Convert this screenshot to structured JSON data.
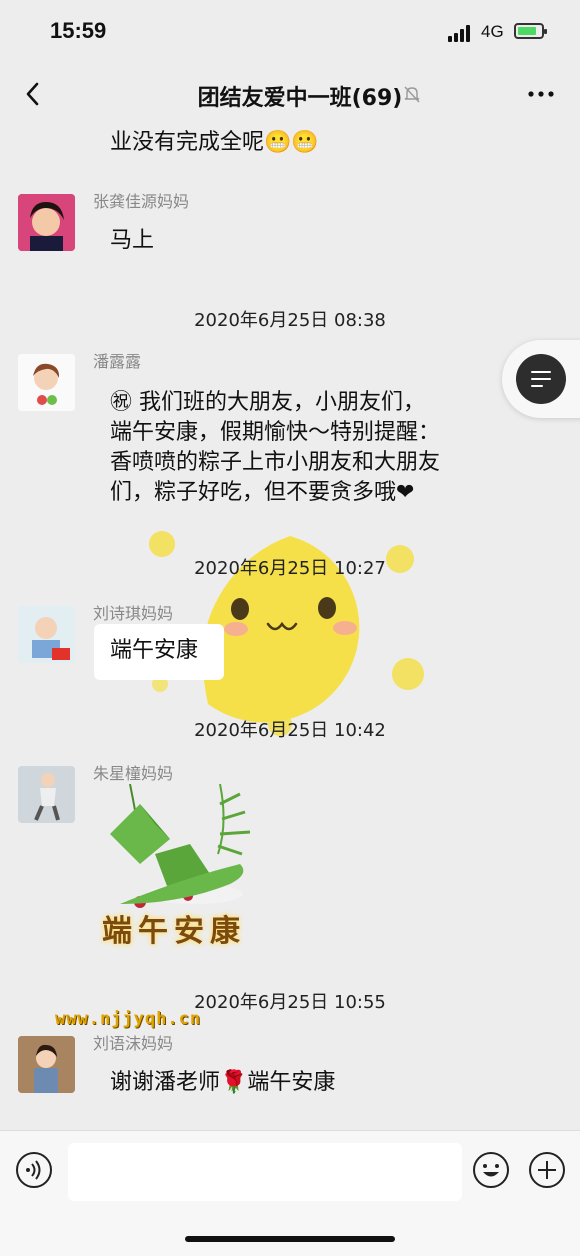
{
  "status_bar": {
    "time": "15:59",
    "network": "4G"
  },
  "header": {
    "title": "团结友爱中一班(69)"
  },
  "messages": [
    {
      "type": "text",
      "text": "业没有完成全呢😬😬"
    },
    {
      "type": "text",
      "sender": "张龚佳源妈妈",
      "text": "马上"
    },
    {
      "type": "timestamp",
      "text": "2020年6月25日 08:38"
    },
    {
      "type": "text",
      "sender": "潘露露",
      "lines": [
        "㊗ 我们班的大朋友，小朋友们，",
        "端午安康，假期愉快～特别提醒：",
        "香喷喷的粽子上市小朋友和大朋友",
        "们，粽子好吃，但不要贪多哦❤"
      ]
    },
    {
      "type": "timestamp",
      "text": "2020年6月25日 10:27"
    },
    {
      "type": "text",
      "sender": "刘诗琪妈妈",
      "text": "端午安康"
    },
    {
      "type": "timestamp",
      "text": "2020年6月25日 10:42"
    },
    {
      "type": "image",
      "sender": "朱星橦妈妈",
      "caption": "端午安康"
    },
    {
      "type": "timestamp",
      "text": "2020年6月25日 10:55"
    },
    {
      "type": "text",
      "sender": "刘语沫妈妈",
      "text": "谢谢潘老师🌹端午安康"
    }
  ],
  "watermark": "www.njjyqh.cn",
  "input": {
    "placeholder": ""
  },
  "colors": {
    "background": "#ededed",
    "moon": "#f5e04a",
    "zongzi_green": "#5aa63a"
  }
}
